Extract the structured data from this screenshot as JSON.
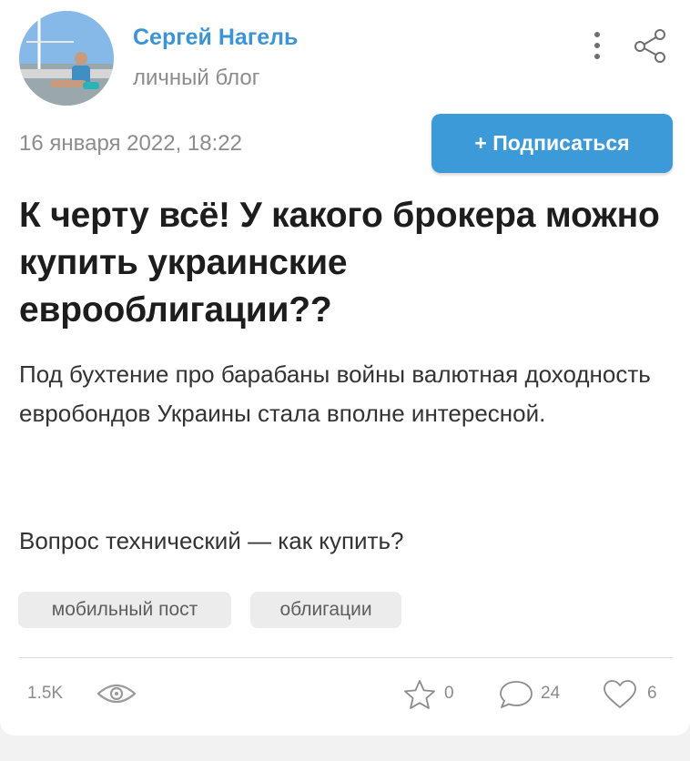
{
  "author": {
    "name": "Сергей Нагель",
    "blog_type": "личный блог"
  },
  "post": {
    "date": "16 января 2022, 18:22",
    "title": "К черту всё! У какого брокера можно купить украинские еврооблигации??",
    "body": "Под бухтение про барабаны войны валютная доходность евробондов Украины стала вполне интересной.",
    "question": "Вопрос технический — как купить?"
  },
  "subscribe_label": "+ Подписаться",
  "tags": [
    "мобильный пост",
    "облигации"
  ],
  "stats": {
    "views": "1.5K",
    "favorites": "0",
    "comments": "24",
    "likes": "6"
  },
  "colors": {
    "accent": "#3d94d3",
    "button": "#3d9ad9",
    "title_text": "#1d1d1d",
    "muted": "#8c8c8c"
  },
  "icons": [
    "more-vertical-icon",
    "share-icon",
    "eye-icon",
    "star-icon",
    "comment-icon",
    "heart-icon"
  ]
}
